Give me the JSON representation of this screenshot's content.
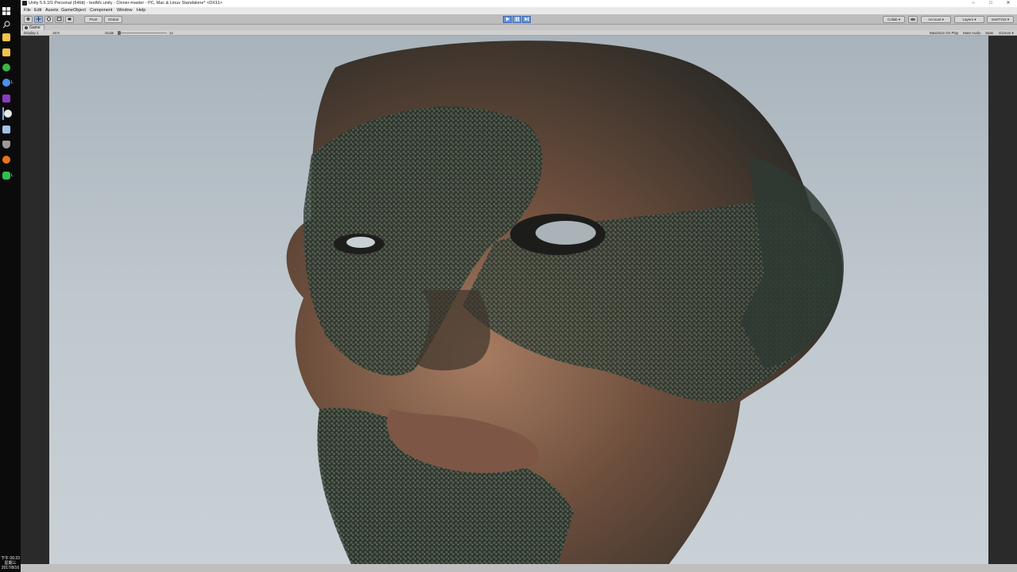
{
  "taskbar": {
    "items": [
      {
        "icon": "start-windows-icon",
        "label": "",
        "color": "#ffffff"
      },
      {
        "icon": "search-icon",
        "label": "",
        "color": "#cccccc"
      },
      {
        "icon": "file-explorer-icon",
        "label": "",
        "color": "#f5c24b"
      },
      {
        "icon": "file-explorer-icon",
        "label": "",
        "color": "#f5c24b"
      },
      {
        "icon": "wechat-icon",
        "label": "",
        "color": "#3bb44a"
      },
      {
        "icon": "app-icon",
        "label": "L",
        "color": "#4d8ff0"
      },
      {
        "icon": "onenote-icon",
        "label": "",
        "color": "#8a3cc0"
      },
      {
        "icon": "unity-icon",
        "label": "",
        "color": "#e8e8e8"
      },
      {
        "icon": "window-icon",
        "label": "",
        "color": "#9fc3e8"
      },
      {
        "icon": "shield-icon",
        "label": "",
        "color": "#9a9a9a"
      },
      {
        "icon": "firefox-icon",
        "label": "",
        "color": "#e8751e"
      },
      {
        "icon": "line-icon",
        "label": "L",
        "color": "#2fbf50"
      }
    ],
    "clock_time": "下午 06:23",
    "clock_day": "星期三",
    "clock_date": "2017/8/16"
  },
  "window": {
    "title": "Unity 5.6.1f1 Personal (64bit) - testMc.unity - Cloner-master - PC, Mac & Linux Standalone* <DX11>"
  },
  "menu": [
    "File",
    "Edit",
    "Assets",
    "GameObject",
    "Component",
    "Window",
    "Help"
  ],
  "toolbar": {
    "pivot": "Pivot",
    "global": "Global",
    "collab": "Collab ▾",
    "account": "Account ▾",
    "layers": "Layers ▾",
    "layout": "newTVs2 ▾"
  },
  "game_view": {
    "tab": "Game",
    "display": "Display 1",
    "aspect": "16:9",
    "scale_label": "Scale",
    "scale_value": "1x",
    "maximize_on_play": "Maximize On Play",
    "mute_audio": "Mute Audio",
    "stats": "Stats",
    "gizmos": "Gizmos ▾",
    "scale": 0.0
  },
  "colors": {
    "play_accent": "#6a93d6",
    "sky_top": "#aeb8c0",
    "sky_bottom": "#c9d1d7",
    "skin": "#7b5a45",
    "cubes": "#2f3d34"
  }
}
